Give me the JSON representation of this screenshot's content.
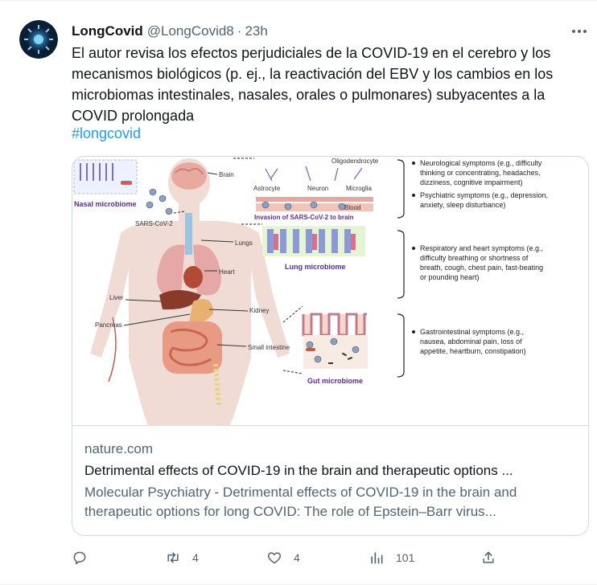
{
  "author": {
    "display_name": "LongCovid",
    "handle": "@LongCovid8",
    "separator": "·",
    "time": "23h"
  },
  "tweet": {
    "text": "El autor revisa los efectos perjudiciales de la COVID-19 en el cerebro y los mecanismos biológicos (p. ej., la reactivación del EBV y los cambios en los microbiomas intestinales, nasales, orales o pulmonares) subyacentes a la COVID prolongada",
    "hashtag": "#longcovid"
  },
  "card": {
    "domain": "nature.com",
    "title": "Detrimental effects of COVID-19 in the brain and therapeutic options ...",
    "description": "Molecular Psychiatry - Detrimental effects of COVID-19 in the brain and therapeutic options for long COVID: The role of Epstein–Barr virus...",
    "figure": {
      "nasal_label": "Nasal microbiome",
      "sars_label": "SARS-CoV-2",
      "brain_label": "Brain",
      "astrocyte_label": "Astrocyte",
      "oligo_label": "Oligodendrocyte",
      "neuron_label": "Neuron",
      "microglia_label": "Microglia",
      "blood_label": "Blood",
      "invasion_label": "Invasion of SARS-CoV-2 to brain",
      "lungs_label": "Lungs",
      "lung_micro_label": "Lung microbiome",
      "heart_label": "Heart",
      "liver_label": "Liver",
      "kidney_label": "Kidney",
      "pancreas_label": "Pancreas",
      "small_int_label": "Small intestine",
      "gut_label": "Gut microbiome",
      "symptoms": {
        "neuro_1": "Neurological symptoms (e.g., difficulty",
        "neuro_2": "thinking or concentrating, headaches,",
        "neuro_3": "dizziness, cognitive impairment)",
        "psych_1": "Psychiatric symptoms (e.g., depression,",
        "psych_2": "anxiety, sleep disturbance)",
        "resp_1": "Respiratory and heart symptoms (e.g.,",
        "resp_2": "difficulty breathing or shortness of",
        "resp_3": "breath, cough, chest pain, fast-beating",
        "resp_4": "or pounding heart)",
        "gi_1": "Gastrointestinal symptoms (e.g.,",
        "gi_2": "nausea, abdominal pain, loss of",
        "gi_3": "appetite, heartburn, constipation)"
      }
    }
  },
  "actions": {
    "reply_count": "",
    "retweet_count": "4",
    "like_count": "4",
    "views_count": "101"
  },
  "icons": {
    "reply": "reply-icon",
    "retweet": "retweet-icon",
    "like": "heart-icon",
    "views": "views-icon",
    "share": "share-icon",
    "more": "more-icon"
  },
  "colors": {
    "link": "#1d9bf0",
    "secondary_text": "#536471",
    "figure_purple": "#5a2f86"
  }
}
